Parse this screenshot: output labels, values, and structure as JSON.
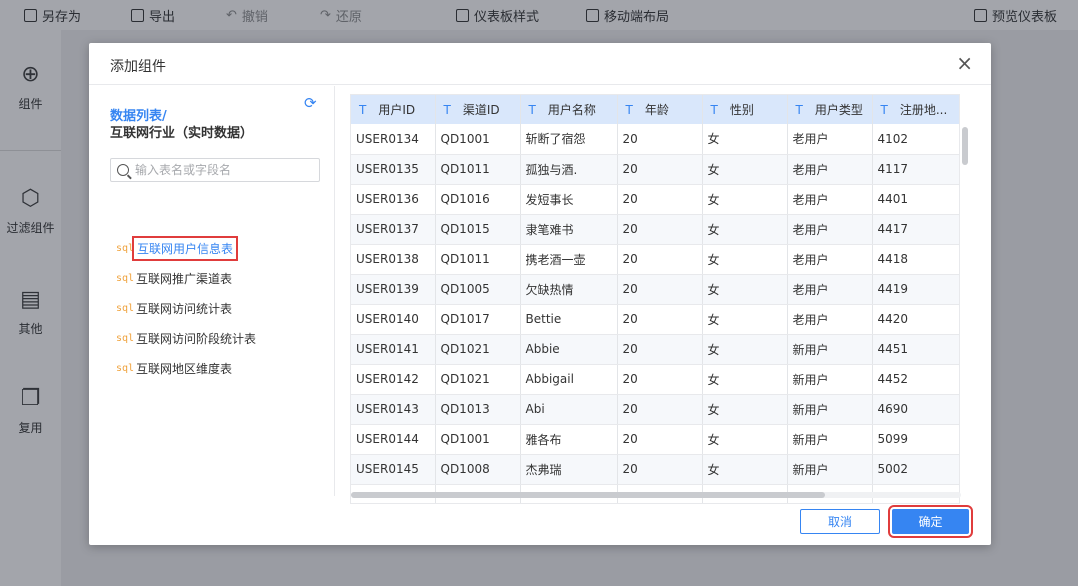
{
  "toolbar": {
    "save_as": "另存为",
    "export": "导出",
    "undo": "撤销",
    "redo": "还原",
    "dashboard_style": "仪表板样式",
    "mobile_layout": "移动端布局",
    "preview": "预览仪表板"
  },
  "rail": {
    "component": "组件",
    "filter": "过滤组件",
    "other": "其他",
    "reuse": "复用"
  },
  "modal": {
    "title": "添加组件",
    "close": "×",
    "breadcrumb_root": "数据列表/",
    "breadcrumb_current": "互联网行业（实时数据）",
    "search_placeholder": "输入表名或字段名",
    "tables": [
      "互联网用户信息表",
      "互联网推广渠道表",
      "互联网访问统计表",
      "互联网访问阶段统计表",
      "互联网地区维度表"
    ],
    "active_table_index": 0,
    "cancel": "取消",
    "confirm": "确定"
  },
  "grid": {
    "type_glyph": "T",
    "columns": [
      "用户ID",
      "渠道ID",
      "用户名称",
      "年龄",
      "性别",
      "用户类型",
      "注册地..."
    ],
    "rows": [
      [
        "USER0134",
        "QD1001",
        "斩断了宿怨",
        "20",
        "女",
        "老用户",
        "4102"
      ],
      [
        "USER0135",
        "QD1011",
        "孤独与酒.",
        "20",
        "女",
        "老用户",
        "4117"
      ],
      [
        "USER0136",
        "QD1016",
        "发短事长",
        "20",
        "女",
        "老用户",
        "4401"
      ],
      [
        "USER0137",
        "QD1015",
        "隶笔难书",
        "20",
        "女",
        "老用户",
        "4417"
      ],
      [
        "USER0138",
        "QD1011",
        "携老酒一壶",
        "20",
        "女",
        "老用户",
        "4418"
      ],
      [
        "USER0139",
        "QD1005",
        "欠缺热情",
        "20",
        "女",
        "老用户",
        "4419"
      ],
      [
        "USER0140",
        "QD1017",
        "Bettie",
        "20",
        "女",
        "老用户",
        "4420"
      ],
      [
        "USER0141",
        "QD1021",
        "Abbie",
        "20",
        "女",
        "新用户",
        "4451"
      ],
      [
        "USER0142",
        "QD1021",
        "Abbigail",
        "20",
        "女",
        "新用户",
        "4452"
      ],
      [
        "USER0143",
        "QD1013",
        "Abi",
        "20",
        "女",
        "新用户",
        "4690"
      ],
      [
        "USER0144",
        "QD1001",
        "雅各布",
        "20",
        "女",
        "新用户",
        "5099"
      ],
      [
        "USER0145",
        "QD1008",
        "杰弗瑞",
        "20",
        "女",
        "新用户",
        "5002"
      ],
      [
        "",
        "",
        "",
        "",
        "",
        "",
        ""
      ]
    ]
  },
  "colors": {
    "accent": "#3685f2",
    "highlight": "#e03c3c",
    "sql_tag": "#f0a23c"
  }
}
